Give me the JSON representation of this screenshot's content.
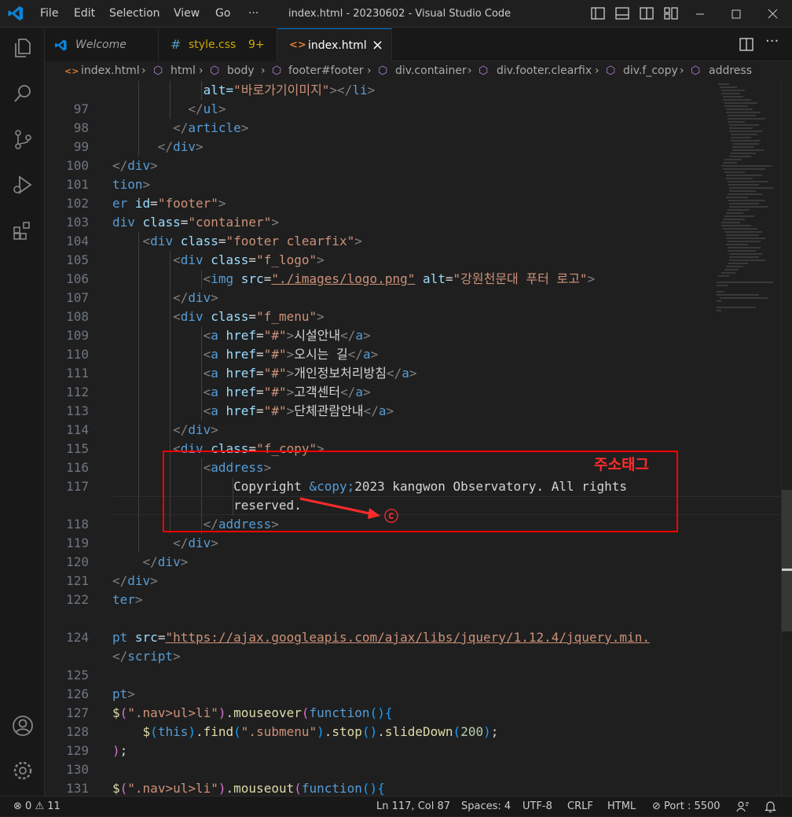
{
  "titlebar": {
    "menu": [
      "File",
      "Edit",
      "Selection",
      "View",
      "Go",
      "···"
    ],
    "window_title": "index.html - 20230602 - Visual Studio Code"
  },
  "tabs": [
    {
      "label": "Welcome",
      "icon": "vscode-icon",
      "active": false
    },
    {
      "label": "style.css",
      "badge": "9+",
      "icon": "css-hash-icon",
      "active": false
    },
    {
      "label": "index.html",
      "icon": "html-icon",
      "active": true,
      "close": "×"
    }
  ],
  "breadcrumb": [
    "index.html",
    "html",
    "body",
    "footer#footer",
    "div.container",
    "div.footer.clearfix",
    "div.f_copy",
    "address"
  ],
  "annotation": {
    "label": "주소태그",
    "copyright_symbol": "ⓒ",
    "color": "#ff0000"
  },
  "lines": {
    "96": "",
    "97": "97",
    "98": "98",
    "99": "99",
    "100": "100",
    "101": "101",
    "102": "102",
    "103": "103",
    "104": "104",
    "105": "105",
    "106": "106",
    "107": "107",
    "108": "108",
    "109": "109",
    "110": "110",
    "111": "111",
    "112": "112",
    "113": "113",
    "114": "114",
    "115": "115",
    "116": "116",
    "117": "117",
    "118": "118",
    "119": "119",
    "120": "120",
    "121": "121",
    "122": "122",
    "124": "124",
    "125": "125",
    "126": "126",
    "127": "127",
    "128": "128",
    "129": "129",
    "130": "130",
    "131": "131"
  },
  "code": {
    "l96_alt": "alt=",
    "l96_val": "\"바로가기이미지\"",
    "l96_tag": "</li>",
    "l102_id": "\"footer\"",
    "l103_cls": "\"container\"",
    "l104_cls": "\"footer clearfix\"",
    "l105_cls": "\"f_logo\"",
    "l106_src": "\"./images/logo.png\"",
    "l106_alt": "\"강원천문대 푸터 로고\"",
    "l108_cls": "\"f_menu\"",
    "l109_txt": "시설안내",
    "l110_txt": "오시는 길",
    "l111_txt": "개인정보처리방침",
    "l112_txt": "고객센터",
    "l113_txt": "단체관람안내",
    "l115_cls": "\"f_copy\"",
    "l117_a": "Copyright ",
    "l117_ent": "&copy;",
    "l117_b": "2023 kangwon Observatory. All rights",
    "l117_c": "reserved.",
    "l124_src": "\"https://ajax.googleapis.com/ajax/libs/jquery/1.12.4/jquery.min.",
    "l127_sel": "\".nav>ul>li\"",
    "l128_sel": "\".submenu\"",
    "l128_num": "200",
    "l131_sel": "\".nav>ul>li\""
  },
  "status": {
    "errors": "0",
    "warnings": "11",
    "position": "Ln 117, Col 87",
    "spaces": "Spaces: 4",
    "encoding": "UTF-8",
    "eol": "CRLF",
    "language": "HTML",
    "port": "Port : 5500"
  }
}
